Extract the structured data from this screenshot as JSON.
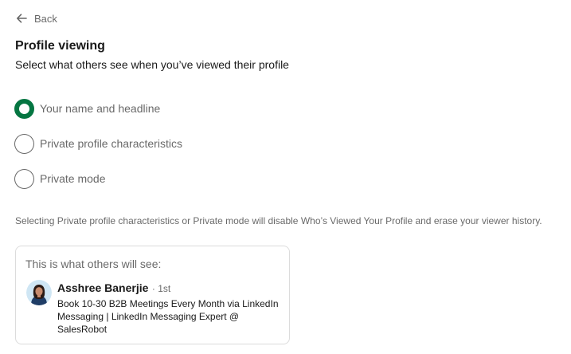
{
  "nav": {
    "back_label": "Back"
  },
  "page": {
    "title": "Profile viewing",
    "subtitle": "Select what others see when you’ve viewed their profile"
  },
  "options": [
    {
      "label": "Your name and headline",
      "selected": true
    },
    {
      "label": "Private profile characteristics",
      "selected": false
    },
    {
      "label": "Private mode",
      "selected": false
    }
  ],
  "note": "Selecting Private profile characteristics or Private mode will disable Who’s Viewed Your Profile and erase your viewer history.",
  "preview": {
    "heading": "This is what others will see:",
    "name": "Asshree Banerjie",
    "degree": "· 1st",
    "headline": "Book 10-30 B2B Meetings Every Month via LinkedIn Messaging | LinkedIn Messaging Expert @ SalesRobot"
  },
  "colors": {
    "accent": "#057642",
    "border": "#dcdcdc",
    "text_secondary": "#666666"
  }
}
